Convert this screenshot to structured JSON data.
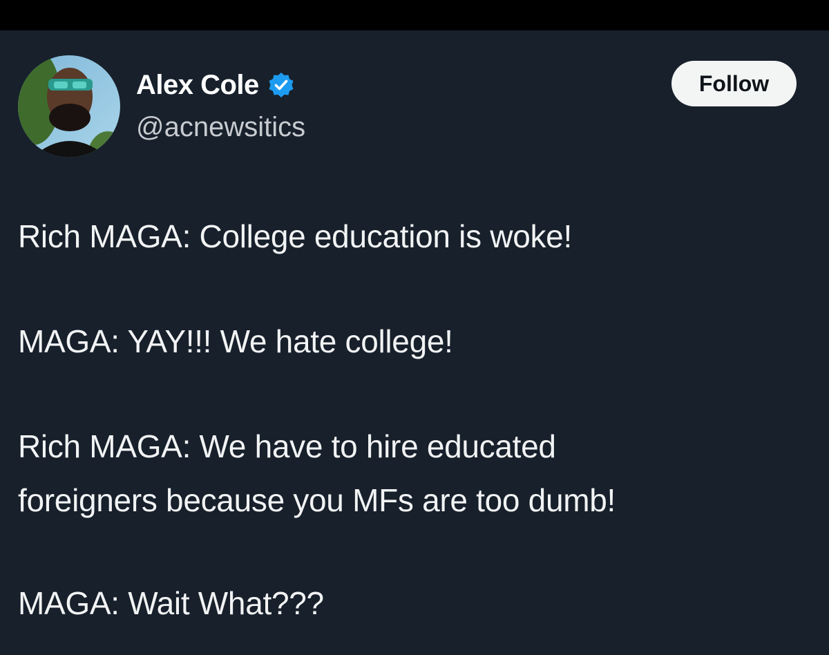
{
  "user": {
    "display_name": "Alex Cole",
    "handle": "@acnewsitics",
    "verified": true,
    "verified_color": "#1d9bf0"
  },
  "follow_button": {
    "label": "Follow"
  },
  "tweet": {
    "lines": [
      "Rich MAGA: College education is woke!",
      "MAGA: YAY!!! We hate college!",
      "Rich MAGA: We have to hire educated",
      "foreigners because you MFs are too dumb!",
      "MAGA: Wait What???"
    ]
  },
  "colors": {
    "background": "#17202b",
    "text": "#e7e9ea",
    "handle": "#c8ccd0"
  },
  "icons": {
    "verified": "verified-badge-icon",
    "avatar": "profile-avatar"
  }
}
